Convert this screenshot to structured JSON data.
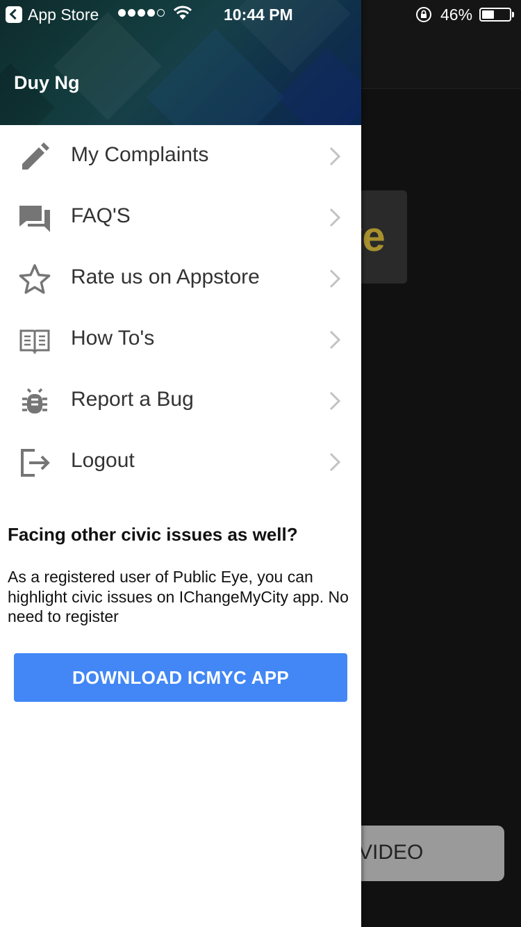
{
  "status_bar": {
    "back_app": "App Store",
    "time": "10:44 PM",
    "battery_percent": "46%",
    "battery_level": 0.46,
    "signal_bars_filled": 4,
    "signal_bars_total": 5
  },
  "background": {
    "logo_fragment": "ye",
    "video_button_fragment": "VIDEO"
  },
  "drawer": {
    "user_name": "Duy Ng",
    "menu": [
      {
        "label": "My Complaints",
        "icon": "pencil-icon"
      },
      {
        "label": "FAQ'S",
        "icon": "chat-bubbles-icon"
      },
      {
        "label": "Rate us on Appstore",
        "icon": "star-icon"
      },
      {
        "label": "How To's",
        "icon": "book-icon"
      },
      {
        "label": "Report a Bug",
        "icon": "bug-icon"
      },
      {
        "label": "Logout",
        "icon": "logout-icon"
      }
    ],
    "civic": {
      "title": "Facing other civic issues as well?",
      "text": "As a registered user of Public Eye, you can highlight civic issues on IChangeMyCity app. No need to register"
    },
    "download_button": "DOWNLOAD ICMYC APP"
  },
  "colors": {
    "accent_button": "#4287f5",
    "icon_gray": "#757575",
    "logo_gold": "#a8912e"
  }
}
